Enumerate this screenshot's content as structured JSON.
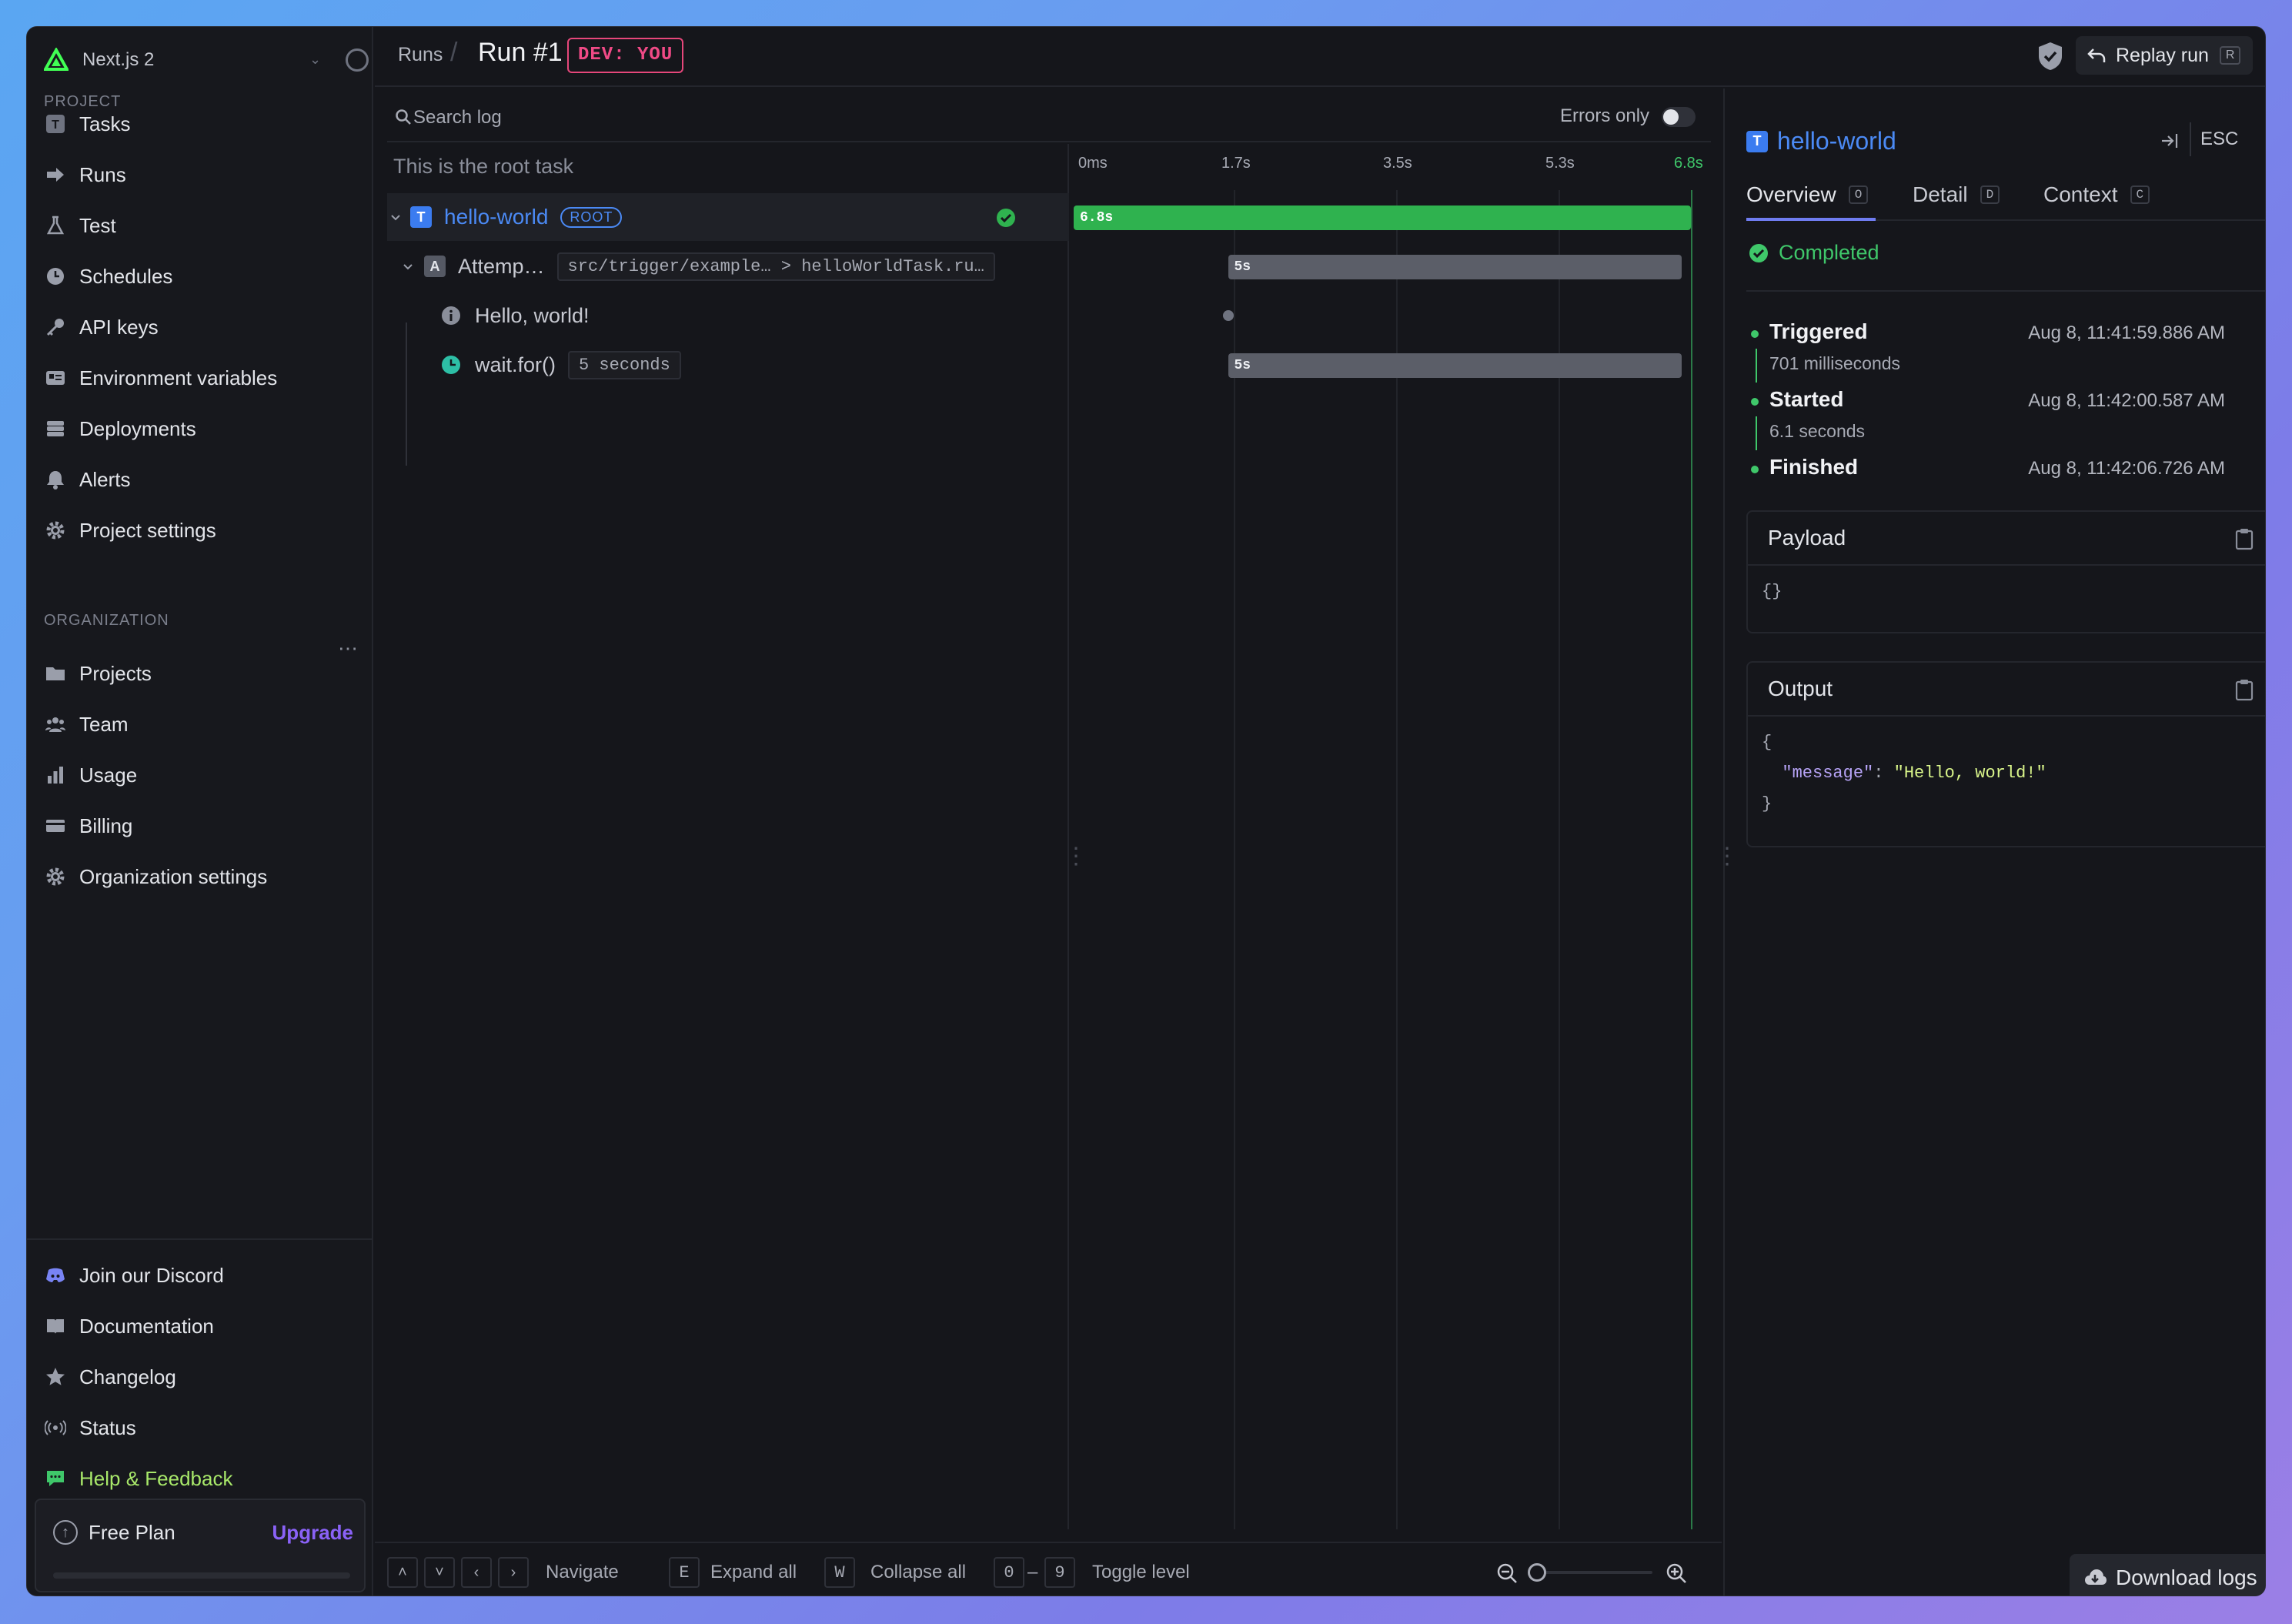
{
  "org": {
    "name": "Next.js 2"
  },
  "sidebar": {
    "project_label": "PROJECT",
    "project_items": [
      {
        "label": "Tasks",
        "icon": "task-icon"
      },
      {
        "label": "Runs",
        "icon": "runs-icon"
      },
      {
        "label": "Test",
        "icon": "beaker-icon"
      },
      {
        "label": "Schedules",
        "icon": "clock-icon"
      },
      {
        "label": "API keys",
        "icon": "key-icon"
      },
      {
        "label": "Environment variables",
        "icon": "env-vars-icon"
      },
      {
        "label": "Deployments",
        "icon": "server-stack-icon"
      },
      {
        "label": "Alerts",
        "icon": "bell-icon"
      },
      {
        "label": "Project settings",
        "icon": "gear-icon"
      }
    ],
    "org_label": "ORGANIZATION",
    "org_items": [
      {
        "label": "Projects",
        "icon": "folder-icon"
      },
      {
        "label": "Team",
        "icon": "team-icon"
      },
      {
        "label": "Usage",
        "icon": "bar-chart-icon"
      },
      {
        "label": "Billing",
        "icon": "credit-card-icon"
      },
      {
        "label": "Organization settings",
        "icon": "gear-icon"
      }
    ],
    "bottom_items": [
      {
        "label": "Join our Discord",
        "icon": "discord-icon"
      },
      {
        "label": "Documentation",
        "icon": "book-icon"
      },
      {
        "label": "Changelog",
        "icon": "star-icon"
      },
      {
        "label": "Status",
        "icon": "signal-icon"
      },
      {
        "label": "Help & Feedback",
        "icon": "chat-icon"
      }
    ],
    "plan": {
      "label": "Free Plan",
      "upgrade": "Upgrade"
    }
  },
  "header": {
    "breadcrumb_runs": "Runs",
    "run_title": "Run #1",
    "env_badge": "DEV: YOU",
    "replay_label": "Replay run",
    "replay_shortcut": "R"
  },
  "log": {
    "search_placeholder": "Search log",
    "errors_only_label": "Errors only",
    "root_hint": "This is the root task",
    "rows": {
      "root": {
        "name": "hello-world",
        "badge": "ROOT",
        "tag": "T"
      },
      "attempt": {
        "name": "Attemp…",
        "tag": "A",
        "path": "src/trigger/example… > helloWorldTask.ru…"
      },
      "log_msg": {
        "text": "Hello, world!"
      },
      "wait": {
        "text": "wait.for()",
        "pill": "5 seconds"
      }
    },
    "ticks": [
      "0ms",
      "1.7s",
      "3.5s",
      "5.3s",
      "6.8s"
    ],
    "bars": {
      "root_label": "6.8s",
      "attempt_label": "5s",
      "wait_label": "5s"
    },
    "footer": {
      "navigate": "Navigate",
      "expand_key": "E",
      "expand": "Expand all",
      "collapse_key": "W",
      "collapse": "Collapse all",
      "level_from": "0",
      "level_dash": "–",
      "level_to": "9",
      "toggle_level": "Toggle level"
    }
  },
  "timeline_data": {
    "total_seconds": 6.8,
    "root": {
      "start": 0,
      "end": 6.8
    },
    "attempt": {
      "start": 1.7,
      "end": 6.7
    },
    "log_event": {
      "at": 1.7
    },
    "wait": {
      "start": 1.7,
      "end": 6.7
    }
  },
  "detail": {
    "title": "hello-world",
    "tag": "T",
    "esc": "ESC",
    "tabs": [
      {
        "label": "Overview",
        "key": "O"
      },
      {
        "label": "Detail",
        "key": "D"
      },
      {
        "label": "Context",
        "key": "C"
      }
    ],
    "status": "Completed",
    "timeline": {
      "triggered": {
        "label": "Triggered",
        "ts": "Aug 8, 11:41:59.886 AM",
        "dur": "701 milliseconds"
      },
      "started": {
        "label": "Started",
        "ts": "Aug 8, 11:42:00.587 AM",
        "dur": "6.1 seconds"
      },
      "finished": {
        "label": "Finished",
        "ts": "Aug 8, 11:42:06.726 AM"
      }
    },
    "payload": {
      "title": "Payload",
      "body": "{}"
    },
    "output": {
      "title": "Output",
      "open": "{",
      "key": "\"message\"",
      "colon": ": ",
      "value": "\"Hello, world!\"",
      "close": "}"
    },
    "download": "Download logs"
  },
  "colors": {
    "accent_blue": "#4b8af5",
    "success": "#3fc76a",
    "env_pink": "#f04a86",
    "upgrade_purple": "#8a62f7"
  }
}
